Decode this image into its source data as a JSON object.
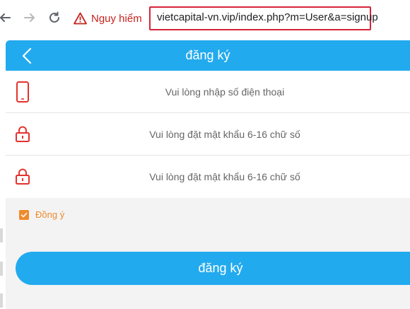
{
  "browser": {
    "security_label": "Nguy hiểm",
    "url": "vietcapital-vn.vip/index.php?m=User&a=signup"
  },
  "app": {
    "title": "đăng ký",
    "fields": [
      {
        "icon": "phone-icon",
        "placeholder": "Vui lòng nhập số điện thoại"
      },
      {
        "icon": "lock-icon",
        "placeholder": "Vui lòng đặt mật khẩu 6-16 chữ số"
      },
      {
        "icon": "lock-icon",
        "placeholder": "Vui lòng đặt mật khẩu 6-16 chữ số"
      }
    ],
    "agree_label": "Đồng ý",
    "agree_checked": true,
    "submit_label": "đăng ký"
  },
  "colors": {
    "accent": "#22aaee",
    "danger": "#c5221f",
    "icon_red": "#e5322d",
    "checkbox": "#f08a2c",
    "url_highlight": "#d6243a"
  }
}
